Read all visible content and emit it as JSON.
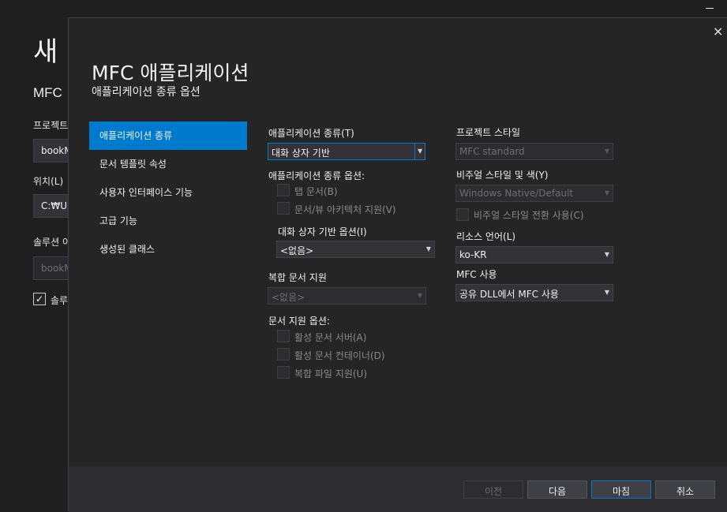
{
  "background": {
    "title": "새",
    "subtitle": "MFC",
    "project_name_label": "프로젝트",
    "project_name_value": "bookM",
    "location_label": "위치(L)",
    "location_value": "C:₩Us",
    "solution_label": "솔루션 이",
    "solution_value": "bookM",
    "solution_dir_check": "✓",
    "solution_dir_label": "솔루"
  },
  "dialog": {
    "close_glyph": "×",
    "title": "MFC 애플리케이션",
    "subtitle": "애플리케이션 종류 옵션",
    "nav": [
      {
        "label": "애플리케이션 종류"
      },
      {
        "label": "문서 템플릿 속성"
      },
      {
        "label": "사용자 인터페이스 기능"
      },
      {
        "label": "고급 기능"
      },
      {
        "label": "생성된 클래스"
      }
    ],
    "app_type_label": "애플리케이션 종류(T)",
    "app_type_value": "대화 상자 기반",
    "app_type_options_label": "애플리케이션 종류 옵션:",
    "tabbed_docs": "탭 문서(B)",
    "doc_view_support": "문서/뷰 아키텍처 지원(V)",
    "dialog_options_label": "대화 상자 기반 옵션(I)",
    "dialog_options_value": "<없음>",
    "compound_label": "복합 문서 지원",
    "compound_value": "<없음>",
    "doc_support_options_label": "문서 지원 옵션:",
    "active_doc_server": "활성 문서 서버(A)",
    "active_doc_container": "활성 문서 컨테이너(D)",
    "compound_file_support": "복합 파일 지원(U)",
    "project_style_label": "프로젝트 스타일",
    "project_style_value": "MFC standard",
    "visual_style_label": "비주얼 스타일 및 색(Y)",
    "visual_style_value": "Windows Native/Default",
    "visual_style_switch": "비주얼 스타일 전환 사용(C)",
    "resource_lang_label": "리소스 언어(L)",
    "resource_lang_value": "ko-KR",
    "mfc_use_label": "MFC 사용",
    "mfc_use_value": "공유 DLL에서 MFC 사용",
    "buttons": {
      "prev": "이전",
      "next": "다음",
      "finish": "마침",
      "cancel": "취소"
    },
    "dropdown_arrow": "▼"
  }
}
